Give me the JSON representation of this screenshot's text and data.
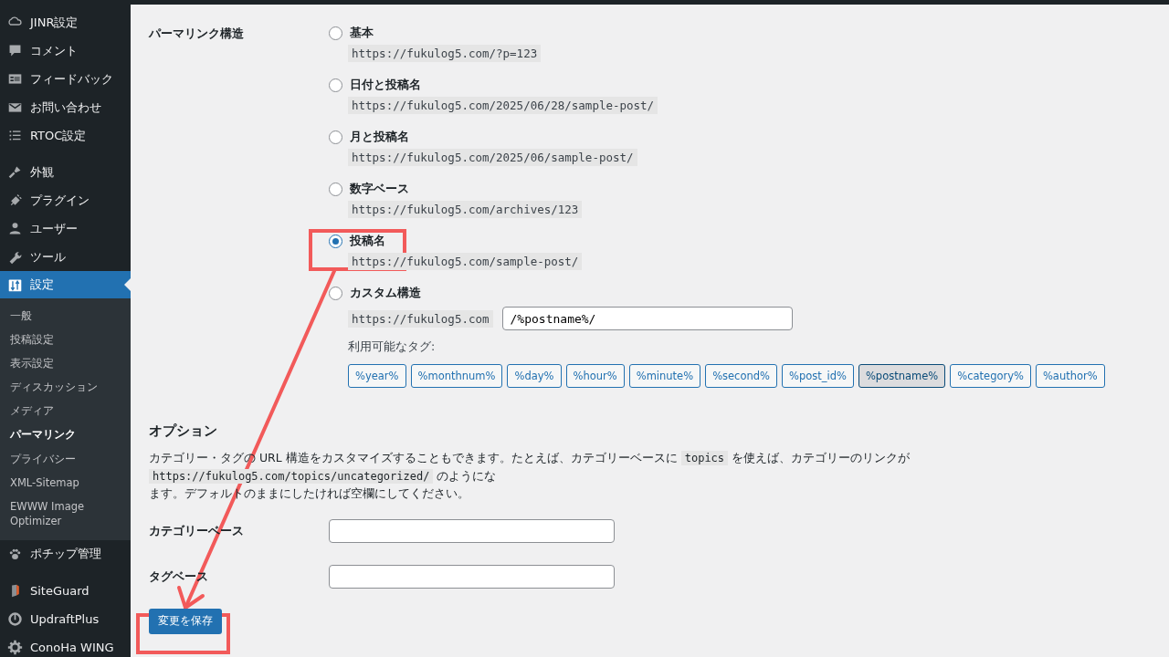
{
  "sidebar": {
    "groups": [
      [
        {
          "label": "JINR設定",
          "selected": false
        },
        {
          "label": "コメント",
          "selected": false
        },
        {
          "label": "フィードバック",
          "selected": false
        },
        {
          "label": "お問い合わせ",
          "selected": false
        },
        {
          "label": "RTOC設定",
          "selected": false
        }
      ],
      [
        {
          "label": "外観",
          "selected": false
        },
        {
          "label": "プラグイン",
          "selected": false
        },
        {
          "label": "ユーザー",
          "selected": false
        },
        {
          "label": "ツール",
          "selected": false
        },
        {
          "label": "設定",
          "selected": true,
          "children": [
            {
              "label": "一般",
              "selected": false
            },
            {
              "label": "投稿設定",
              "selected": false
            },
            {
              "label": "表示設定",
              "selected": false
            },
            {
              "label": "ディスカッション",
              "selected": false
            },
            {
              "label": "メディア",
              "selected": false
            },
            {
              "label": "パーマリンク",
              "selected": true
            },
            {
              "label": "プライバシー",
              "selected": false
            },
            {
              "label": "XML-Sitemap",
              "selected": false
            },
            {
              "label": "EWWW Image Optimizer",
              "selected": false
            }
          ]
        },
        {
          "label": "ポチップ管理",
          "selected": false
        }
      ],
      [
        {
          "label": "SiteGuard",
          "selected": false
        },
        {
          "label": "UpdraftPlus",
          "selected": false
        },
        {
          "label": "ConoHa WING",
          "selected": false
        }
      ]
    ]
  },
  "permalink": {
    "label": "パーマリンク構造",
    "options": [
      {
        "kind": "preset",
        "label": "基本",
        "example": "https://fukulog5.com/?p=123",
        "selected": false
      },
      {
        "kind": "preset",
        "label": "日付と投稿名",
        "example": "https://fukulog5.com/2025/06/28/sample-post/",
        "selected": false
      },
      {
        "kind": "preset",
        "label": "月と投稿名",
        "example": "https://fukulog5.com/2025/06/sample-post/",
        "selected": false
      },
      {
        "kind": "preset",
        "label": "数字ベース",
        "example": "https://fukulog5.com/archives/123",
        "selected": false
      },
      {
        "kind": "preset",
        "label": "投稿名",
        "example": "https://fukulog5.com/sample-post/",
        "selected": true
      },
      {
        "kind": "custom",
        "label": "カスタム構造",
        "prefix": "https://fukulog5.com",
        "value": "/%postname%/",
        "selected": false
      }
    ],
    "tags_label": "利用可能なタグ:",
    "tags": [
      {
        "label": "%year%",
        "selected": false
      },
      {
        "label": "%monthnum%",
        "selected": false
      },
      {
        "label": "%day%",
        "selected": false
      },
      {
        "label": "%hour%",
        "selected": false
      },
      {
        "label": "%minute%",
        "selected": false
      },
      {
        "label": "%second%",
        "selected": false
      },
      {
        "label": "%post_id%",
        "selected": false
      },
      {
        "label": "%postname%",
        "selected": true
      },
      {
        "label": "%category%",
        "selected": false
      },
      {
        "label": "%author%",
        "selected": false
      }
    ]
  },
  "options": {
    "heading": "オプション",
    "description": [
      {
        "kind": "text",
        "text": "カテゴリー・タグの URL 構造をカスタマイズすることもできます。たとえば、カテゴリーベースに "
      },
      {
        "kind": "code",
        "text": "topics"
      },
      {
        "kind": "text",
        "text": " を使えば、カテゴリーのリンクが "
      },
      {
        "kind": "code",
        "text": "https://fukulog5.com/topics/uncategorized/"
      },
      {
        "kind": "text",
        "text": " のようにな"
      }
    ],
    "description_end": "ます。デフォルトのままにしたければ空欄にしてください。",
    "fields": [
      {
        "label": "カテゴリーベース"
      },
      {
        "label": "タグベース"
      }
    ]
  },
  "save_button": "変更を保存"
}
